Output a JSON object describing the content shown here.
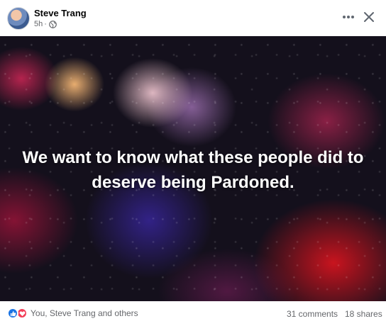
{
  "post": {
    "author": "Steve Trang",
    "time": "5h",
    "separator": "·",
    "audience_icon": "globe-icon",
    "menu_icon": "more-options-icon",
    "close_icon": "close-icon",
    "image_caption": "We want to know what these people did to deserve being Pardoned."
  },
  "footer": {
    "reaction_icons": [
      "like-icon",
      "love-icon"
    ],
    "reactors_text": "You, Steve Trang and others",
    "comments_text": "31 comments",
    "shares_text": "18 shares"
  },
  "colors": {
    "like": "#1b74e4",
    "love": "#f33e58",
    "secondary_text": "#65676b"
  }
}
